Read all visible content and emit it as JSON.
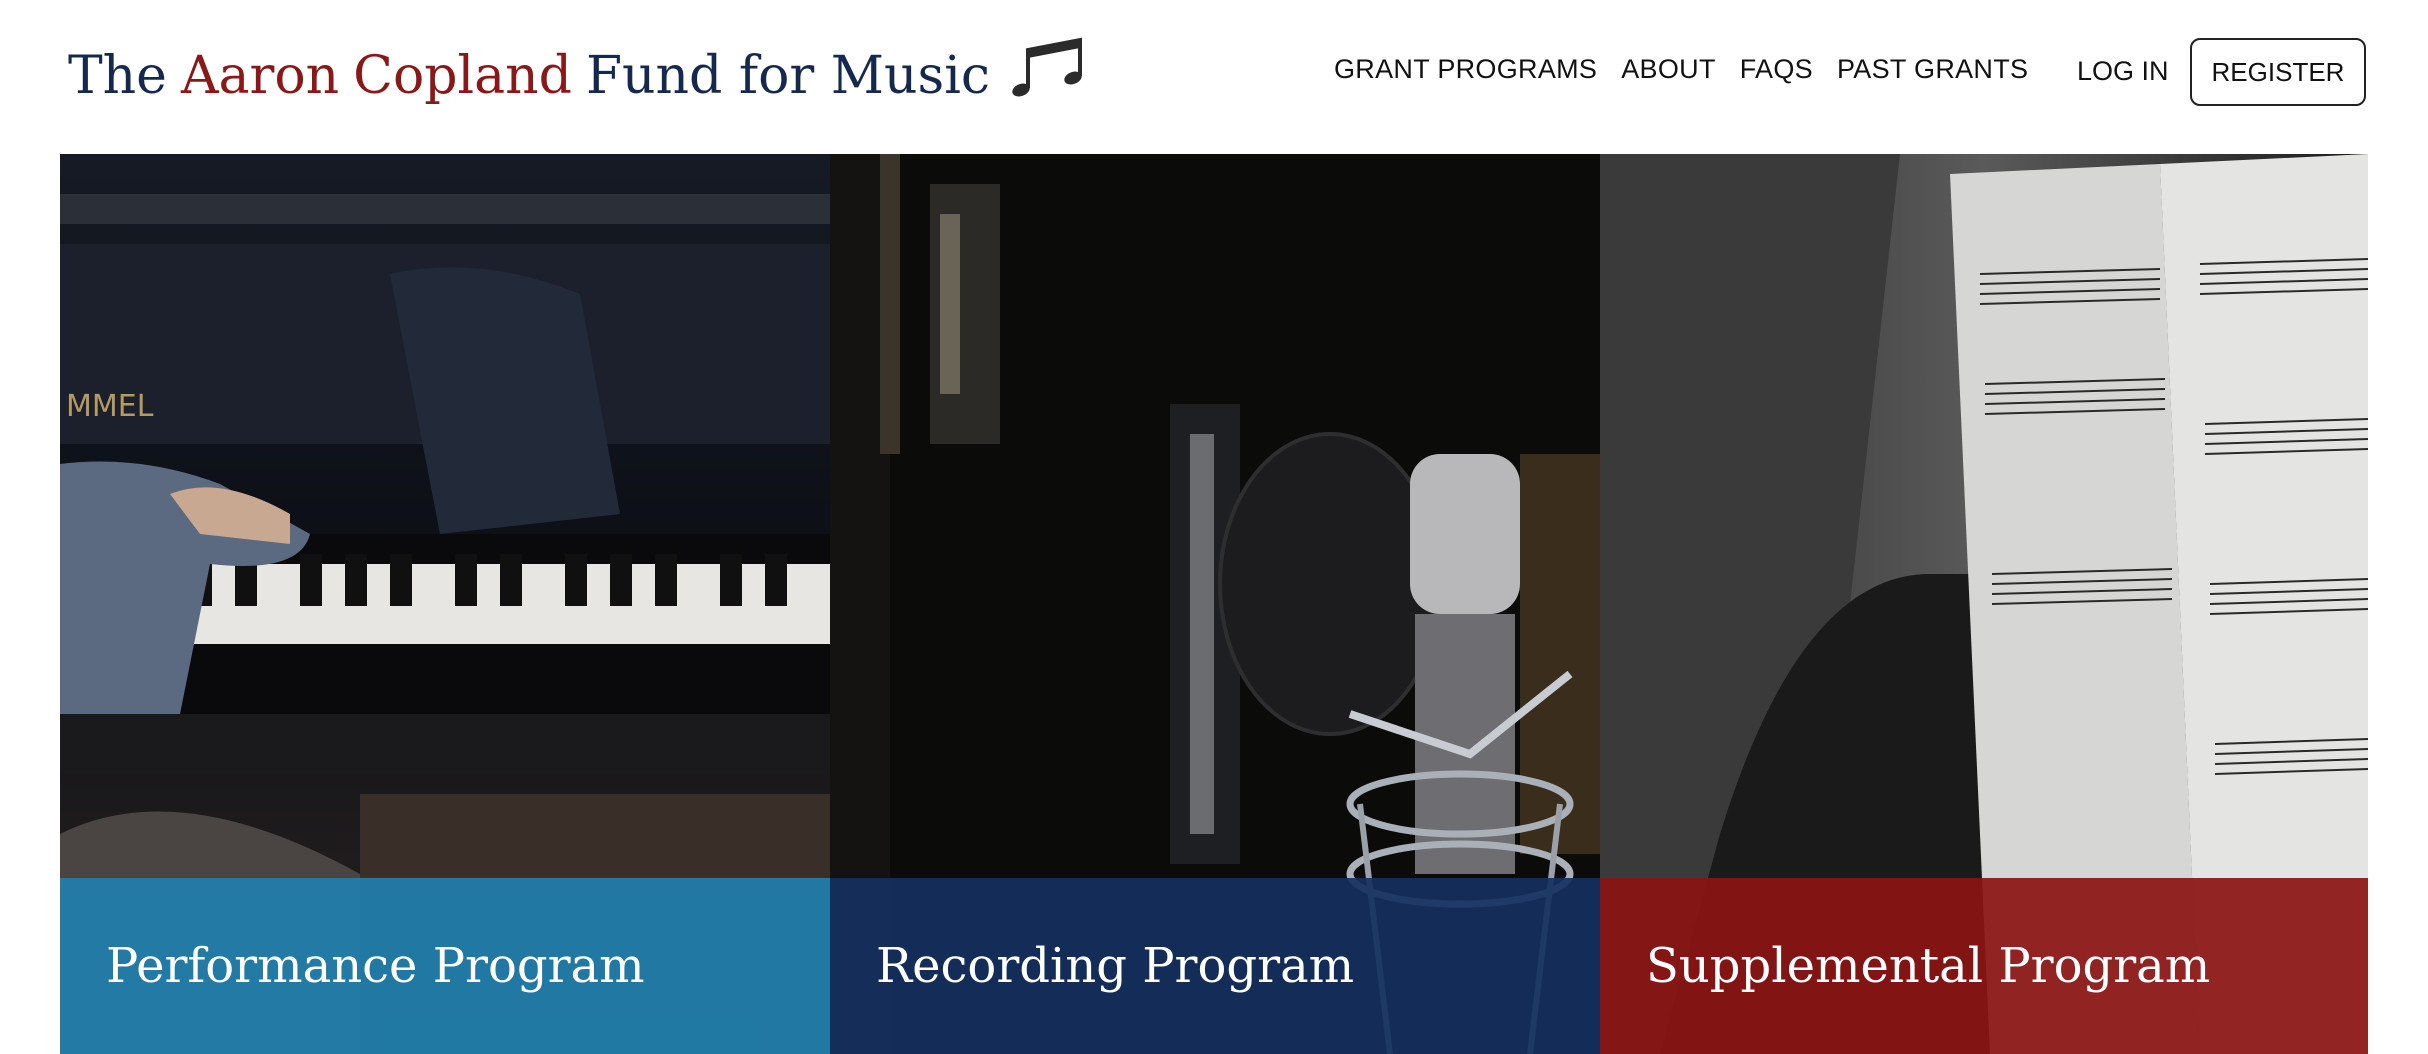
{
  "header": {
    "logo": {
      "word_the": "The",
      "word_aaron": "Aaron",
      "word_copland": "Copland",
      "word_rest": "Fund for Music",
      "icon": "music-notes-icon"
    },
    "nav": [
      {
        "label": "GRANT PROGRAMS"
      },
      {
        "label": "ABOUT"
      },
      {
        "label": "FAQS"
      },
      {
        "label": "PAST GRANTS"
      }
    ],
    "login_label": "LOG IN",
    "register_label": "REGISTER"
  },
  "programs": [
    {
      "label": "Performance Program",
      "image": "piano-keys-photo",
      "band_color": "#1e7fae"
    },
    {
      "label": "Recording Program",
      "image": "studio-microphone-photo",
      "band_color": "#15305f"
    },
    {
      "label": "Supplemental Program",
      "image": "sheet-music-photo",
      "band_color": "#8c1414"
    }
  ],
  "colors": {
    "navy": "#15294f",
    "crimson": "#8b1818"
  }
}
